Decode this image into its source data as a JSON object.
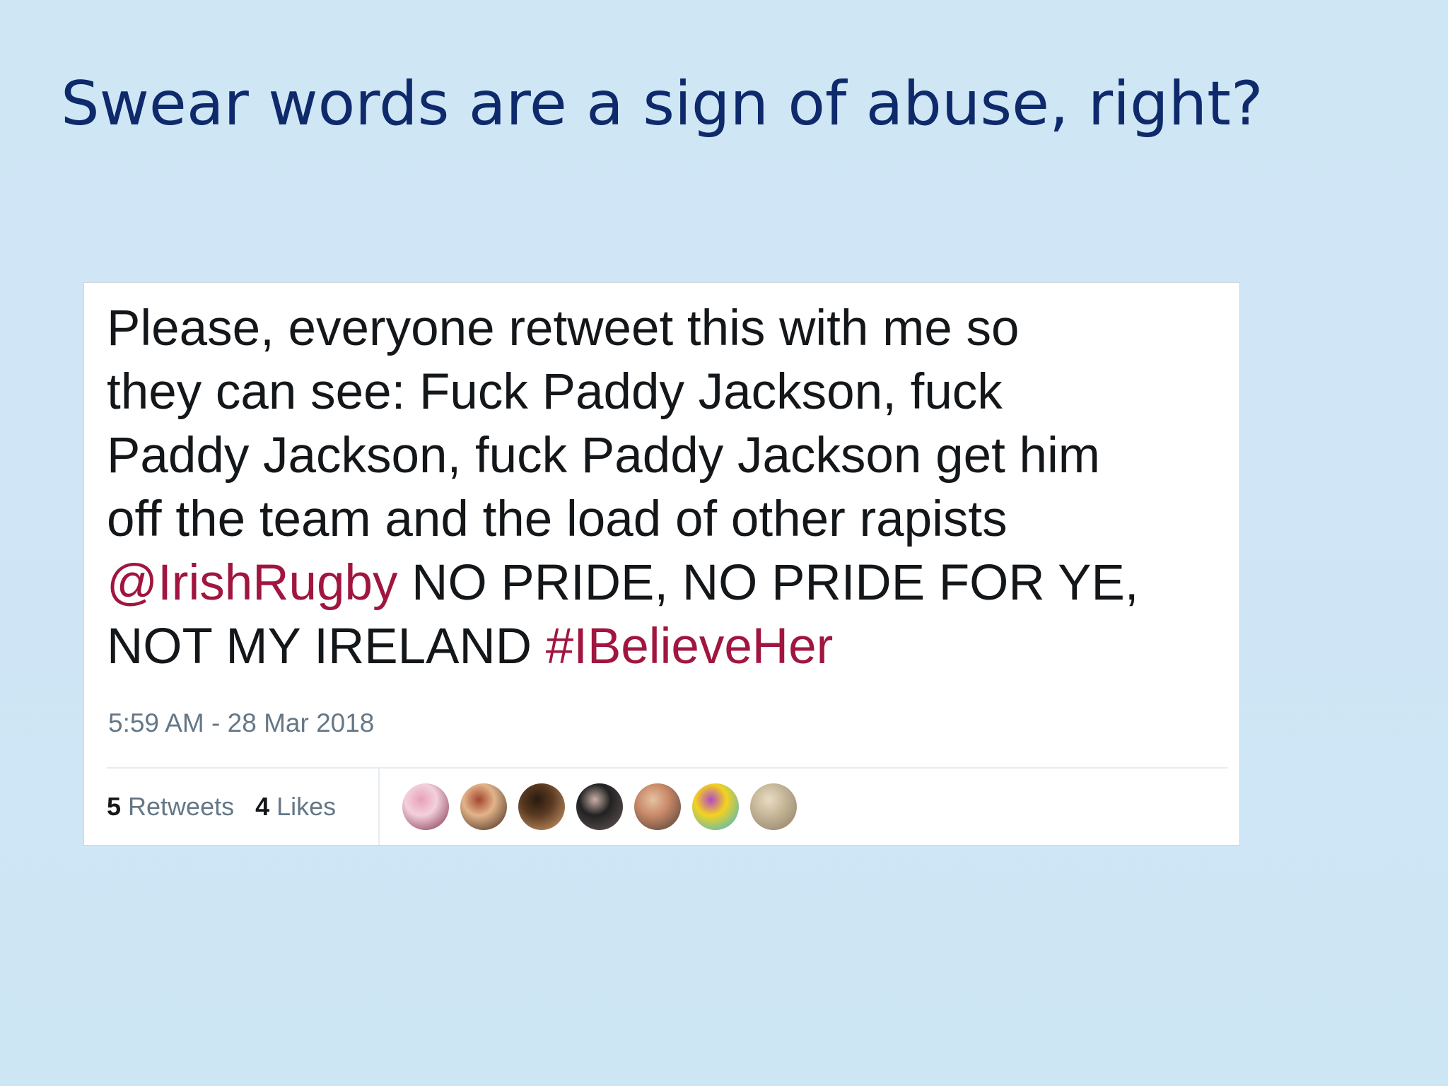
{
  "slide": {
    "title": "Swear words are a sign of abuse, right?"
  },
  "tweet": {
    "lines": [
      [
        {
          "text": "Please, everyone retweet this with me so"
        }
      ],
      [
        {
          "text": "they can see: Fuck Paddy Jackson, fuck"
        }
      ],
      [
        {
          "text": "Paddy Jackson, fuck Paddy Jackson get him"
        }
      ],
      [
        {
          "text": "off the team and the load of other rapists"
        }
      ],
      [
        {
          "text": "@IrishRugby",
          "link": true
        },
        {
          "text": " NO PRIDE, NO PRIDE FOR YE,"
        }
      ],
      [
        {
          "text": "NOT MY IRELAND "
        },
        {
          "text": "#IBelieveHer",
          "link": true
        }
      ]
    ],
    "timestamp": "5:59 AM - 28 Mar 2018",
    "retweets": {
      "count": "5",
      "label": "Retweets"
    },
    "likes": {
      "count": "4",
      "label": "Likes"
    },
    "avatars": [
      {
        "name": "avatar-1",
        "colors": [
          "#f3d1dc",
          "#7a2a44",
          "#e8a0b8"
        ]
      },
      {
        "name": "avatar-2",
        "colors": [
          "#e2b48a",
          "#3a2216",
          "#a4462e"
        ]
      },
      {
        "name": "avatar-3",
        "colors": [
          "#5a3a22",
          "#d8a070",
          "#2a1a10"
        ]
      },
      {
        "name": "avatar-4",
        "colors": [
          "#222222",
          "#6a5a5a",
          "#c9b0a8"
        ]
      },
      {
        "name": "avatar-5",
        "colors": [
          "#c98a6a",
          "#4a3a30",
          "#e6c2a0"
        ]
      },
      {
        "name": "avatar-6",
        "colors": [
          "#f4d21f",
          "#2ab3e6",
          "#b24ac6"
        ]
      },
      {
        "name": "avatar-7",
        "colors": [
          "#c8b89a",
          "#8a7a62",
          "#e8dcc4"
        ]
      }
    ]
  },
  "colors": {
    "title": "#0e2a6b",
    "link": "#a0163f",
    "text": "#14171a",
    "meta": "#657786"
  }
}
